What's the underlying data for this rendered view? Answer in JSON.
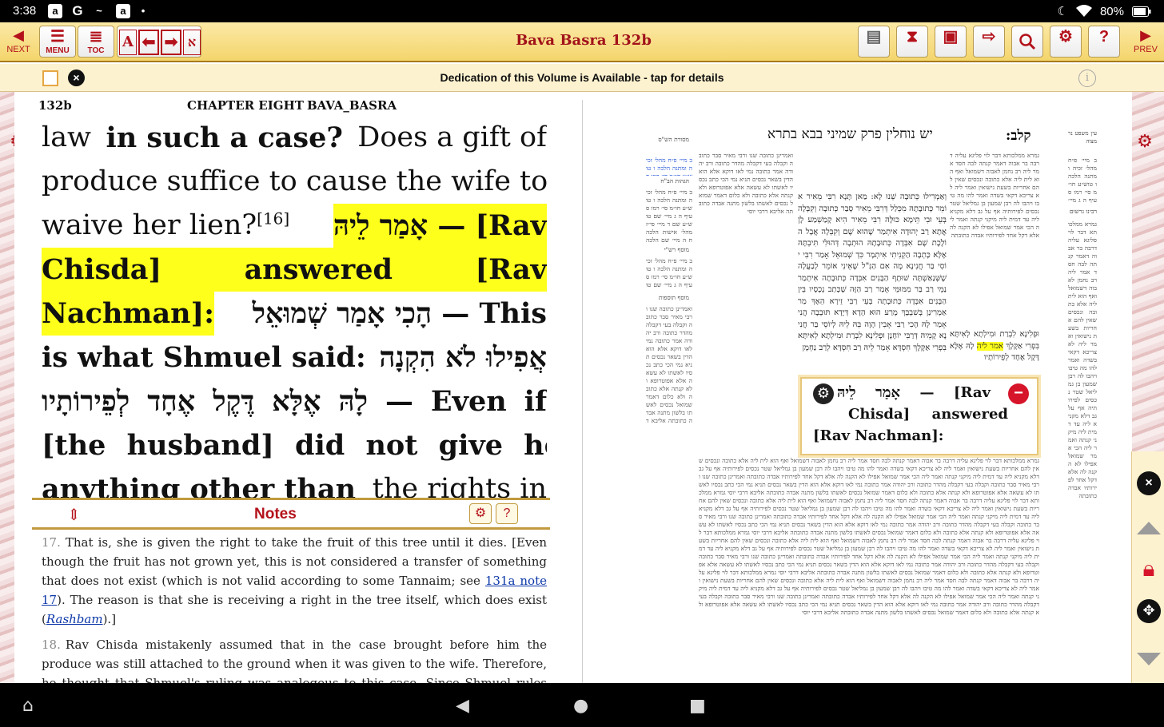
{
  "status_bar": {
    "time": "3:38",
    "notif_icons": [
      "a",
      "G",
      "~",
      "a",
      "•"
    ],
    "battery": "80%"
  },
  "toolbar": {
    "next_label": "NEXT",
    "prev_label": "PREV",
    "menu_label": "MENU",
    "toc_label": "TOC",
    "font_glyph": "A",
    "title": "Bava Basra 132b",
    "tools": [
      "page-view-icon",
      "hourglass-icon",
      "briefcase-icon",
      "arrow-right-icon",
      "search-icon",
      "gear-icon",
      "help-icon"
    ]
  },
  "dedication": {
    "text": "Dedication of this Volume is Available - tap for details",
    "info_glyph": "i"
  },
  "left_page": {
    "page_num": "132b",
    "chapter": "CHAPTER EIGHT",
    "tractate": "BAVA_BASRA",
    "lines": [
      [
        "law",
        "in such a case?",
        "Does a gift of"
      ],
      [
        "produce suffice to cause the wife to"
      ],
      [
        "waive her lien?",
        "[16]",
        "אָמַר לֵיהּ — [Rav"
      ],
      [
        "Chisda]",
        "answered",
        "[Rav"
      ],
      [
        "Nachman]:",
        "הָכִי אָמַר שְׁמוּאֵל — This"
      ],
      [
        "is what Shmuel said:",
        "אֲפִילוּ לֹא הִקְנָה"
      ],
      [
        "לָהּ אֶלָּא דֶּקֶל אֶחָד לְפֵירוֹתָיו — Even if"
      ],
      [
        "[the husband] did not give her"
      ],
      [
        "anything other than",
        "the rights in"
      ]
    ]
  },
  "notes": {
    "title": "Notes",
    "items": [
      {
        "num": "17.",
        "text_a": "That is, she is given the right to take the fruit of this tree until it dies. [Even though the fruit has not grown yet, this is not considered a transfer of something that does not exist (which is not valid according to some Tannaim; see ",
        "link": "131a note 17",
        "text_b": "). The reason is that she is receiving a right in the tree itself, which does exist (",
        "link2": "Rashbam",
        "text_c": ").]"
      },
      {
        "num": "18.",
        "text": "Rav Chisda mistakenly assumed that in the case brought before him the produce was still attached to the ground when it was given to the wife. Therefore, he thought that Shmuel's ruling was analogous to this case. Since Shmuel rules that a right in a tree has the status of land (in this context), the same can be said about attached"
      }
    ]
  },
  "right_page": {
    "header": "יש נוחלין פרק שמיני בבא בתרא",
    "folio": "קלב:",
    "corner_label": "עין משפט נר מצוה",
    "side_label_1": "מסורת הש\"ס",
    "side_label_2": "הגהות הב\"ח",
    "side_label_3": "מוסף רש\"י",
    "side_label_4": "מוסף תוספות",
    "side_label_5": "רבינו גרשום",
    "gemara_lines": [
      "וְאַמְרִילוּ כְּתוּבָה שְׁנוּ לָא: מַאן תָּנָא רִבִּי מֵאִיר אוֹמֵר",
      "כְּתוּבָתָהּ מִכְּלַל דְּרִבִּי מֵאִיר סָבַר כְּתוּבָה וְקִבְּלָה בְּעֵי",
      "וּבִי תֵּימָא כּוּלָּהּ רִבִּי מֵאִיר הִיא קָמַשְׁמַע לָן אֲתָא רַב",
      "יְהוּדָה אִיתְמַר שֶׁהוּא שֶׁם וְקִבְּלָה אֲבָל",
      "הוֹלֶכֶת שֶׁם אִבְּדָה כְּתוּבָתָהּ הוּתְבָה דְּהוּלִּי",
      "תִּיבְתָּהּ אֶלָּא כָּתְבָה הַקְנִיתִי אִיתְמָר כִּדְ",
      "שְׁמוּאֵל אָמַר רִבִּי יוֹסִי בַּר חֲנִינָא מָה אִם",
      "הַנִּ\"ל שֶׁאֵינִי אוֹמֵר לְבַעֲלָה שֶׁשְּׁנַאַשְׁתָּה שׁוּתָף",
      "הַבָּנִים אִבְּדָה כְּתוּבָתָה אִיתְמַר נַמֵּי",
      "רַב בַּר מִמּוּמֵּי אָמַר רַב הַזֶּה שֶׁכָּתַב נְכָסָיו",
      "בֵּין הַבָּנִים אִבְּדָה כְּתוּבָתָה בְּעֵי רַבִּי זֵירָא",
      "הֵאָךְ מַר אַמְרִינַן בְּשִׁבְבָּךְ מָרַע הוּא הָדָא דְּיָדָא",
      "תּוּבְבָה הֲנִי אָמַר לָהּ הָכִי רַבִּי אָבִין הָוָה",
      "בֵּהּ לֵיהּ לְיוֹסֵי בַּר חֲנִינָא קָמֵיהּ דְּרַבִּי יוֹחָנָן",
      "וּפְלִינָא לִבְרַת וּמִילְתָא לְאִיתָּא בִּפְרִי אַקֶּלֶךְ",
      "חִסְדָּא אָמַר לֵיהּ רַב חִסְדָּא לְרַב נַחְמָן",
      "לָהּ אֶלָּא דֶּקֶל אֶחָד לְפֵירוֹתָיו"
    ],
    "highlight_word": "אמר ליה",
    "popup": {
      "lines": [
        "אָמַר לֵיהּ — [Rav",
        "Chisda] answered",
        "[Rav Nachman]:"
      ]
    },
    "rashi_sample": "גמרא ממלכותא דבר לוי פליגא עליה דרבה בר אבוה דאמר קנתה לבה חסד אמר ליה רב נחמן לאבוה דשמואל ואף הוא לית ליה אלא כתובה ונכסים שאין להם אחריות בשעת נישואין ואמר ליה לא צריכא דקאי בשדה ואמר להו מה טיבו ויהבו לה רבן שמעון בן גמליאל שטר נכסים לפירותיה אף על גב דלא מקניא ליה עד דמית ליה מיקני קנתה ואמר ליה הכי אמר שמואל אפילו לא הקנה לה אלא דקל אחד לפירותיו אבדה כתובתה ",
    "tosafot_sample": "ואמרינן כתובה שנו ורבי מאיר סבר כתובה וקבלה בעי דקבלה מהדר כתובה ורב יהודה אמר כתובה נמי לאו דוקא אלא הוא הדין בשאר נכסים תניא נמי הכי כתב נכסיו לאשתו לא עשאה אלא אפוטרופא ולא קנתה אלא כתובה ולא כלום דאמר שמואל נכסים לאשתו בלשון מתנה אבדה כתובתה אליבא דרבי יוסי ",
    "margin_sample": "ב מיי׳ פ״ח מהל׳ זכיה ומתנה הלכה ו טוש״ע חו״מ סי׳ רמו סעיף ה ג מיי׳ שם טוש״ע שם ד מיי׳ פי״ז מהל׳ אישות הלכה ח ה מיי׳ שם הלכה ט "
  },
  "side_controls": {
    "close_glyph": "×"
  },
  "colors": {
    "accent": "#b4121b",
    "toolbar_bg": "#f4d56c",
    "highlight": "#ffff1c"
  }
}
